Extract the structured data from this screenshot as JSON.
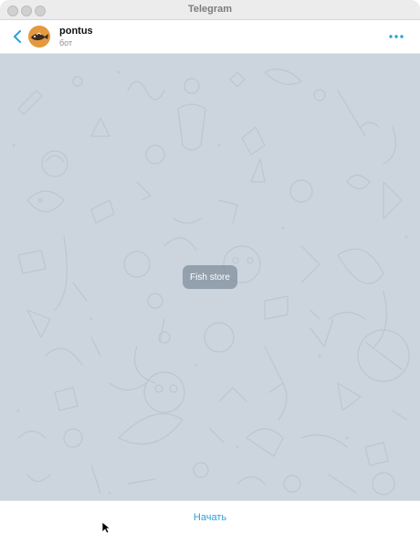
{
  "window": {
    "title": "Telegram"
  },
  "header": {
    "chat_name": "pontus",
    "status": "бот",
    "back_icon": "chevron-left-icon",
    "more_icon": "more-dots-icon"
  },
  "chat": {
    "service_message": "Fish store"
  },
  "bottom": {
    "start_label": "Начать"
  },
  "colors": {
    "accent": "#2ba2d6",
    "chat_background": "#ccd5de",
    "service_bubble": "#7d8c9b"
  }
}
